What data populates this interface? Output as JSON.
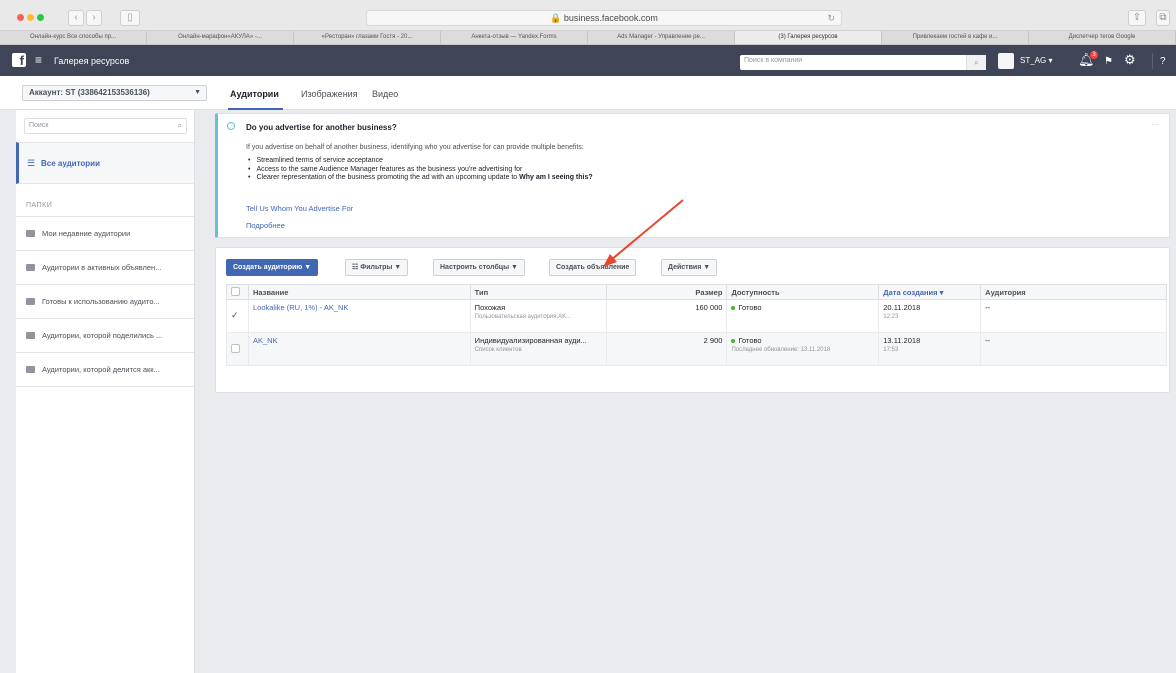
{
  "browser": {
    "url": "business.facebook.com",
    "tabs": [
      "Онлайн-курс Все способы пр...",
      "Онлайн-марафон«АКУЛА» -...",
      "«Ресторан» глазами Гостя - 20...",
      "Анкета-отзыв — Yandex.Forms",
      "Ads Manager - Управление ре...",
      "(3) Галерея ресурсов",
      "Привлекаем гостей в кафе и...",
      "Диспетчер тегов Google"
    ],
    "active_tab": "(3) Галерея ресурсов"
  },
  "fbbar": {
    "title": "Галерея ресурсов",
    "search_placeholder": "Поиск в компании",
    "user": "ST_AG",
    "notif_count": "3"
  },
  "subheader": {
    "account": "Аккаунт: ST (338642153536136)",
    "tabs": [
      "Аудитории",
      "Изображения",
      "Видео"
    ]
  },
  "sidebar": {
    "search_placeholder": "Поиск",
    "active_item": "Все аудитории",
    "folders_label": "ПАПКИ",
    "items": [
      "Мои недавние аудитории",
      "Аудитории в активных объявлен...",
      "Готовы к использованию аудито...",
      "Аудитории, которой поделились ...",
      "Аудитории, которой делится акк..."
    ]
  },
  "info": {
    "title": "Do you advertise for another business?",
    "description": "If you advertise on behalf of another business, identifying who you advertise for can provide multiple benefits:",
    "bullets": [
      "Streamlined terms of service acceptance",
      "Access to the same Audience Manager features as the business you're advertising for",
      "Clearer representation of the business promoting the ad with an upcoming update to"
    ],
    "bullet3_bold": "Why am I seeing this?",
    "link1": "Tell Us Whom You Advertise For",
    "link2": "Подробнее",
    "more": "···"
  },
  "toolbar": {
    "create_audience": "Создать аудиторию",
    "filters": "Фильтры",
    "configure_columns": "Настроить столбцы",
    "create_ad": "Создать объявление",
    "actions": "Действия"
  },
  "table": {
    "headers": {
      "name": "Название",
      "type": "Тип",
      "size": "Размер",
      "availability": "Доступность",
      "created": "Дата создания",
      "audience": "Аудитория"
    },
    "rows": [
      {
        "name": "Lookalike (RU, 1%) - AK_NK",
        "type": "Похожая",
        "type_sub": "Пользовательская аудитория:AK...",
        "size": "160 000",
        "availability": "Готово",
        "availability_sub": "",
        "date": "20.11.2018",
        "time": "12:23",
        "audience": "--"
      },
      {
        "name": "AK_NK",
        "type": "Индивидуализированная ауди...",
        "type_sub": "Список клиентов",
        "size": "2 900",
        "availability": "Готово",
        "availability_sub": "Последнее обновление: 13.11.2018",
        "date": "13.11.2018",
        "time": "17:53",
        "audience": "--"
      }
    ]
  },
  "colors": {
    "fb_header": "#3f4456",
    "brand_blue": "#4267b2",
    "ready_green": "#42b72a",
    "annotation_arrow": "#e8452c"
  }
}
